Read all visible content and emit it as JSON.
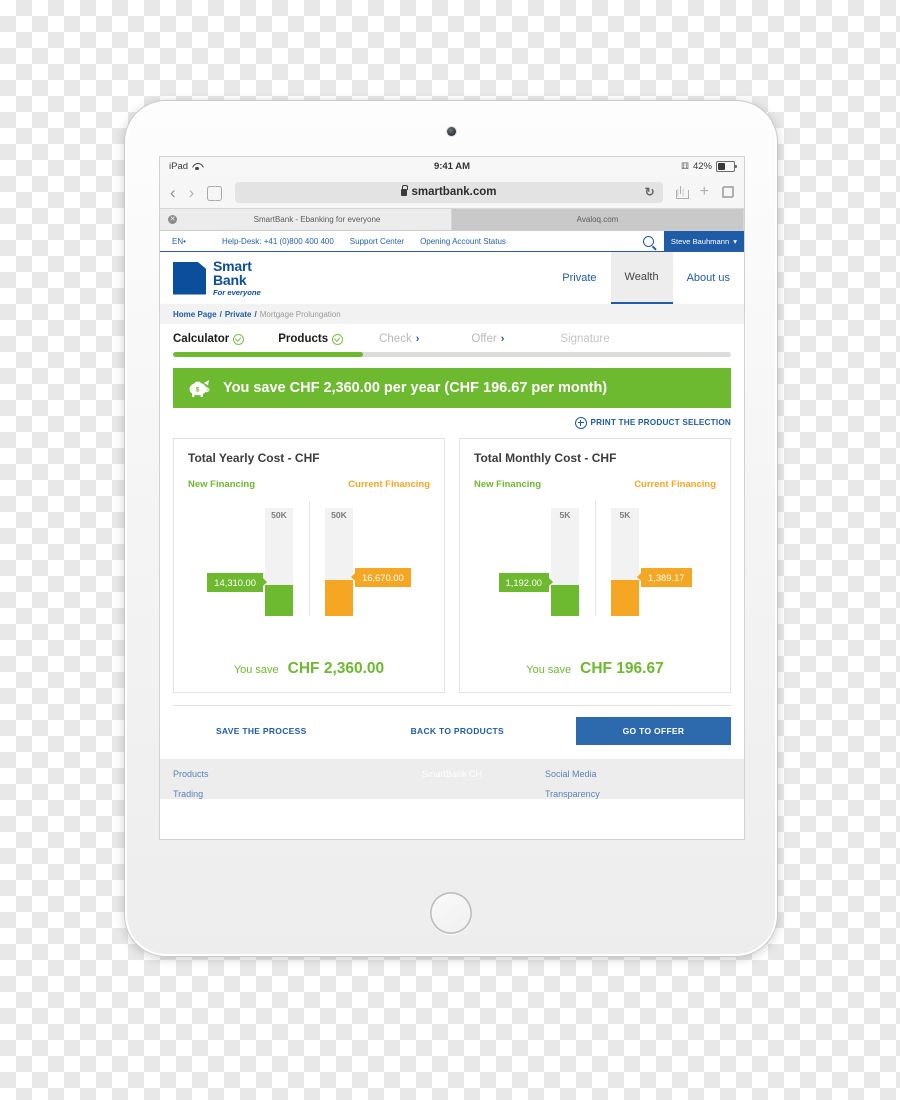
{
  "device": {
    "name": "iPad"
  },
  "status_bar": {
    "carrier": "iPad",
    "time": "9:41 AM",
    "battery_percent": "42%",
    "wifi_icon": "wifi-icon",
    "bluetooth_icon": "bluetooth-icon",
    "battery_icon": "battery-icon"
  },
  "safari": {
    "back_icon": "chevron-left-icon",
    "forward_icon": "chevron-right-icon",
    "bookmarks_icon": "book-icon",
    "lock_icon": "lock-icon",
    "url": "smartbank.com",
    "reload_icon": "reload-icon",
    "share_icon": "share-icon",
    "new_tab_icon": "plus-icon",
    "tabs_icon": "tabs-icon",
    "tabs": [
      {
        "title": "SmartBank - Ebanking for everyone",
        "selected": true,
        "close_icon": "close-icon"
      },
      {
        "title": "Avaloq.com",
        "selected": false
      }
    ]
  },
  "meta_bar": {
    "language": "EN",
    "language_caret": "•",
    "helpdesk": "Help-Desk: +41 (0)800 400 400",
    "support": "Support Center",
    "account_status": "Opening Account Status",
    "search_icon": "search-icon",
    "user_name": "Steve Bauhmann",
    "user_caret": "▾"
  },
  "brand": {
    "logo_icon": "smartbank-logo-icon",
    "line1": "Smart",
    "line2": "Bank",
    "tagline": "For everyone"
  },
  "topnav": [
    {
      "label": "Private",
      "active": false
    },
    {
      "label": "Wealth",
      "active": true
    },
    {
      "label": "About us",
      "active": false
    }
  ],
  "breadcrumb": {
    "home": "Home Page",
    "sep1": "/",
    "section": "Private",
    "sep2": "/",
    "current": "Mortgage Prolungation"
  },
  "steps": [
    {
      "label": "Calculator",
      "state": "done",
      "icon": "check-circle-icon"
    },
    {
      "label": "Products",
      "state": "done",
      "icon": "check-circle-icon"
    },
    {
      "label": "Check",
      "state": "todo",
      "icon": "chevron-right-icon"
    },
    {
      "label": "Offer",
      "state": "todo",
      "icon": "chevron-right-icon"
    },
    {
      "label": "Signature",
      "state": "todo",
      "icon": ""
    }
  ],
  "progress": {
    "percent": 34
  },
  "banner": {
    "icon": "piggy-bank-icon",
    "text": "You save CHF 2,360.00 per year (CHF 196.67 per month)",
    "bg_color": "#6db92f"
  },
  "print_link": {
    "icon": "plus-circle-icon",
    "label": "PRINT THE PRODUCT SELECTION"
  },
  "chart_data": [
    {
      "type": "bar",
      "title": "Total Yearly Cost - CHF",
      "categories": [
        "New Financing",
        "Current Financing"
      ],
      "values": [
        14310.0,
        16670.0
      ],
      "value_labels": [
        "14,310.00",
        "16,670.00"
      ],
      "axis_cap_labels": [
        "50K",
        "50K"
      ],
      "ylim": [
        0,
        50000
      ],
      "colors": [
        "#6db92f",
        "#f5a623"
      ],
      "grid": false,
      "legend": "top",
      "xlabel": "",
      "ylabel": "CHF",
      "annotation_label": "You save",
      "annotation_value": "CHF 2,360.00"
    },
    {
      "type": "bar",
      "title": "Total Monthly Cost - CHF",
      "categories": [
        "New Financing",
        "Current Financing"
      ],
      "values": [
        1192.0,
        1389.17
      ],
      "value_labels": [
        "1,192.00",
        "1,389.17"
      ],
      "axis_cap_labels": [
        "5K",
        "5K"
      ],
      "ylim": [
        0,
        5000
      ],
      "colors": [
        "#6db92f",
        "#f5a623"
      ],
      "grid": false,
      "legend": "top",
      "xlabel": "",
      "ylabel": "CHF",
      "annotation_label": "You save",
      "annotation_value": "CHF 196.67"
    }
  ],
  "actions": {
    "save_process": "SAVE THE PROCESS",
    "back_to_products": "BACK TO PRODUCTS",
    "go_to_offer": "GO TO OFFER"
  },
  "footer": {
    "col1": {
      "head": "Products",
      "link": "Trading"
    },
    "col2": {
      "head": "SmartBank CH"
    },
    "col3": {
      "head": "Social Media",
      "link": "Transparency"
    }
  }
}
